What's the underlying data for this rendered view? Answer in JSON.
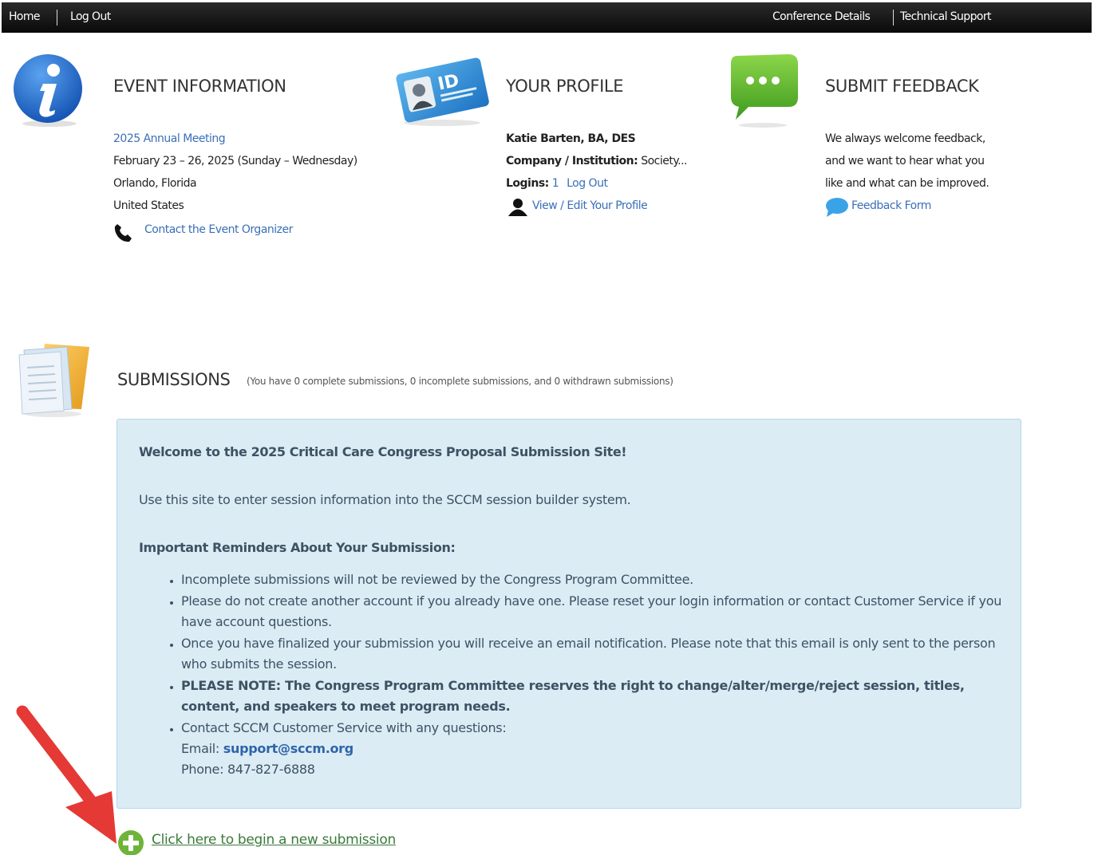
{
  "nav": {
    "home": "Home",
    "logout": "Log Out",
    "conference_details": "Conference Details",
    "technical_support": "Technical Support"
  },
  "event": {
    "heading": "EVENT INFORMATION",
    "meeting_link": "2025 Annual Meeting",
    "dates": "February 23 – 26, 2025 (Sunday – Wednesday)",
    "city": "Orlando, Florida",
    "country": "United States",
    "contact_link": "Contact the Event Organizer"
  },
  "profile": {
    "heading": "YOUR PROFILE",
    "name": "Katie Barten, BA, DES",
    "company_label": "Company / Institution:",
    "company_value": "Society...",
    "logins_label": "Logins:",
    "logins_count": "1",
    "logout_link": "Log Out",
    "edit_link": "View / Edit Your Profile"
  },
  "feedback": {
    "heading": "SUBMIT FEEDBACK",
    "line1": "We always welcome feedback,",
    "line2": "and we want to hear what you",
    "line3": "like and what can be improved.",
    "form_link": "Feedback Form"
  },
  "submissions": {
    "heading": "SUBMISSIONS",
    "summary": "(You have 0 complete submissions, 0 incomplete submissions, and 0 withdrawn submissions)",
    "welcome": "Welcome to the 2025 Critical Care Congress Proposal Submission Site!",
    "intro": "Use this site to enter session information into the SCCM session builder system.",
    "reminders_title": "Important Reminders About Your Submission:",
    "reminders": [
      "Incomplete submissions will not be reviewed by the Congress Program Committee.",
      "Please do not create another account if you already have one. Please reset your login information or contact Customer Service if you have account questions.",
      "Once you have finalized your submission you will receive an email notification. Please note that this email is only sent to the person who submits the session.",
      "PLEASE NOTE: The Congress Program Committee reserves the right to change/alter/merge/reject session, titles, content, and speakers to meet program needs.",
      "Contact SCCM Customer Service with any questions:"
    ],
    "email_label": "Email:",
    "email": "support@sccm.org",
    "phone": "Phone: 847-827-6888",
    "new_submission_link": "Click here to begin a new submission"
  },
  "colors": {
    "link": "#3a6fb8",
    "panel_bg": "#dbecf5",
    "panel_text": "#3d5263",
    "new_submission": "#3a7a3a",
    "annotation_arrow": "#e53935"
  }
}
